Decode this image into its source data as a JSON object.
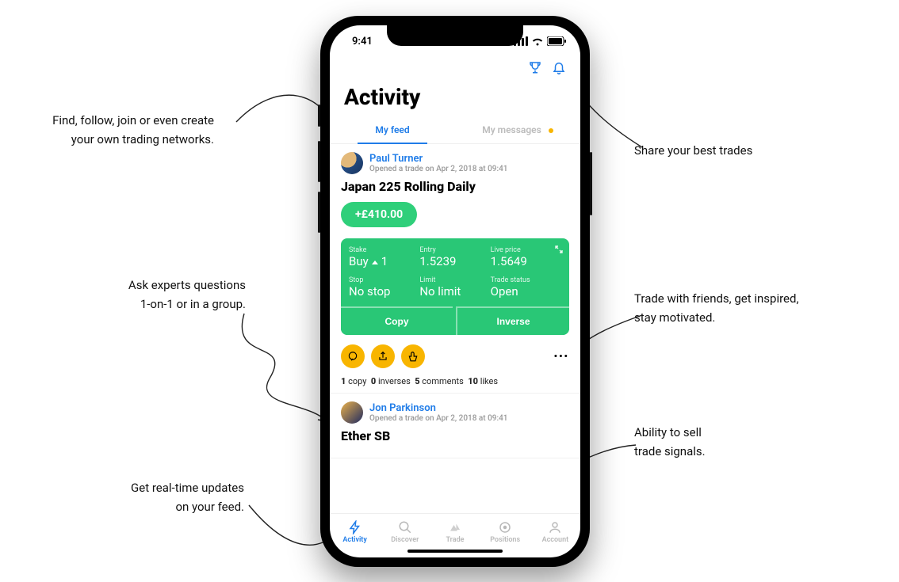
{
  "status_bar": {
    "time": "9:41"
  },
  "header": {
    "page_title": "Activity"
  },
  "tabs": [
    {
      "label": "My feed",
      "active": true
    },
    {
      "label": "My messages",
      "active": false,
      "badge": true
    }
  ],
  "feed": [
    {
      "user": "Paul Turner",
      "subtitle": "Opened a trade on Apr 2, 2018 at 09:41",
      "instrument": "Japan 225 Rolling Daily",
      "pnl": "+£410.00",
      "details": {
        "stake_label": "Stake",
        "stake_value_prefix": "Buy",
        "stake_value_suffix": "1",
        "entry_label": "Entry",
        "entry_value": "1.5239",
        "live_label": "Live price",
        "live_value": "1.5649",
        "stop_label": "Stop",
        "stop_value": "No stop",
        "limit_label": "Limit",
        "limit_value": "No limit",
        "status_label": "Trade status",
        "status_value": "Open"
      },
      "actions": {
        "copy": "Copy",
        "inverse": "Inverse"
      },
      "stats": {
        "copies_n": "1",
        "copies_l": "copy",
        "inverses_n": "0",
        "inverses_l": "inverses",
        "comments_n": "5",
        "comments_l": "comments",
        "likes_n": "10",
        "likes_l": "likes"
      }
    },
    {
      "user": "Jon Parkinson",
      "subtitle": "Opened a trade on Apr 2, 2018 at 09:41",
      "instrument": "Ether SB"
    }
  ],
  "bottom_nav": [
    {
      "label": "Activity",
      "active": true
    },
    {
      "label": "Discover",
      "active": false
    },
    {
      "label": "Trade",
      "active": false
    },
    {
      "label": "Positions",
      "active": false
    },
    {
      "label": "Account",
      "active": false
    }
  ],
  "annotations": {
    "a1_l1": "Find, follow, join or even create",
    "a1_l2": "your own trading networks.",
    "a2": "Share your best trades",
    "a3_l1": "Ask experts questions",
    "a3_l2": "1-on-1 or in a group.",
    "a4_l1": "Trade with friends, get inspired,",
    "a4_l2": "stay motivated.",
    "a5": "Ability to sell",
    "a5b": "trade signals.",
    "a6_l1": "Get real-time updates",
    "a6_l2": "on your feed."
  },
  "colors": {
    "accent_blue": "#1f7ce8",
    "accent_green": "#29c776",
    "accent_yellow": "#f8b500"
  }
}
